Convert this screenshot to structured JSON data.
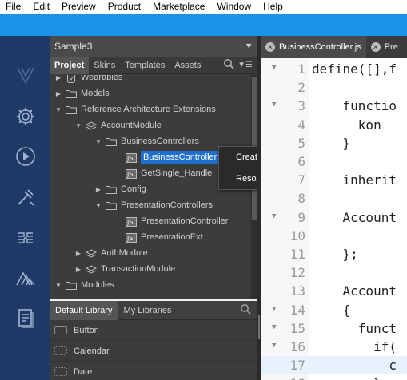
{
  "menubar": [
    "File",
    "Edit",
    "Preview",
    "Product",
    "Marketplace",
    "Window",
    "Help"
  ],
  "project_panel": {
    "title": "Sample3",
    "tabs": [
      "Project",
      "Skins",
      "Templates",
      "Assets"
    ],
    "tree": [
      {
        "label": "Wearables",
        "depth": 0,
        "arrow": "right",
        "icon": "wearable-icon"
      },
      {
        "label": "Models",
        "depth": 0,
        "arrow": "right",
        "icon": "folder-icon"
      },
      {
        "label": "Reference Architecture Extensions",
        "depth": 0,
        "arrow": "down",
        "icon": "folder-icon"
      },
      {
        "label": "AccountModule",
        "depth": 1,
        "arrow": "down",
        "icon": "module-icon"
      },
      {
        "label": "BusinessControllers",
        "depth": 2,
        "arrow": "down",
        "icon": "folder-icon"
      },
      {
        "label": "BusinessController",
        "depth": 3,
        "arrow": "",
        "icon": "js-file-icon",
        "selected": true
      },
      {
        "label": "GetSingle_Handle",
        "depth": 3,
        "arrow": "",
        "icon": "js-file-icon"
      },
      {
        "label": "Config",
        "depth": 2,
        "arrow": "right",
        "icon": "folder-icon"
      },
      {
        "label": "PresentationControllers",
        "depth": 2,
        "arrow": "down",
        "icon": "folder-icon"
      },
      {
        "label": "PresentationController",
        "depth": 3,
        "arrow": "",
        "icon": "js-file-icon"
      },
      {
        "label": "PresentationExt",
        "depth": 3,
        "arrow": "",
        "icon": "js-file-icon"
      },
      {
        "label": "AuthModule",
        "depth": 1,
        "arrow": "right",
        "icon": "module-icon"
      },
      {
        "label": "TransactionModule",
        "depth": 1,
        "arrow": "right",
        "icon": "module-icon"
      },
      {
        "label": "Modules",
        "depth": 0,
        "arrow": "down",
        "icon": "folder-icon"
      }
    ]
  },
  "context_menu": {
    "items": [
      "Create New Command",
      "Resource Location"
    ]
  },
  "library_panel": {
    "tabs": [
      "Default Library",
      "My Libraries"
    ],
    "items": [
      "Button",
      "Calendar",
      "Date"
    ]
  },
  "editor": {
    "tabs": [
      "BusinessController.js",
      "Pre"
    ],
    "lines": [
      {
        "n": "1",
        "fold": "▼",
        "text": "define([],f"
      },
      {
        "n": "2",
        "fold": "",
        "text": ""
      },
      {
        "n": "3",
        "fold": "▼",
        "text": "    functio"
      },
      {
        "n": "4",
        "fold": "",
        "text": "      kon"
      },
      {
        "n": "5",
        "fold": "",
        "text": "    }"
      },
      {
        "n": "6",
        "fold": "",
        "text": ""
      },
      {
        "n": "7",
        "fold": "",
        "text": "    inherit"
      },
      {
        "n": "8",
        "fold": "",
        "text": ""
      },
      {
        "n": "9",
        "fold": "▼",
        "text": "    Account"
      },
      {
        "n": "10",
        "fold": "",
        "text": ""
      },
      {
        "n": "11",
        "fold": "",
        "text": "    };"
      },
      {
        "n": "12",
        "fold": "",
        "text": ""
      },
      {
        "n": "13",
        "fold": "",
        "text": "    Account"
      },
      {
        "n": "14",
        "fold": "▼",
        "text": "    {"
      },
      {
        "n": "15",
        "fold": "▼",
        "text": "      funct"
      },
      {
        "n": "16",
        "fold": "▼",
        "text": "        if("
      },
      {
        "n": "17",
        "fold": "",
        "text": "          c"
      },
      {
        "n": "18",
        "fold": "",
        "text": "        }"
      }
    ]
  }
}
